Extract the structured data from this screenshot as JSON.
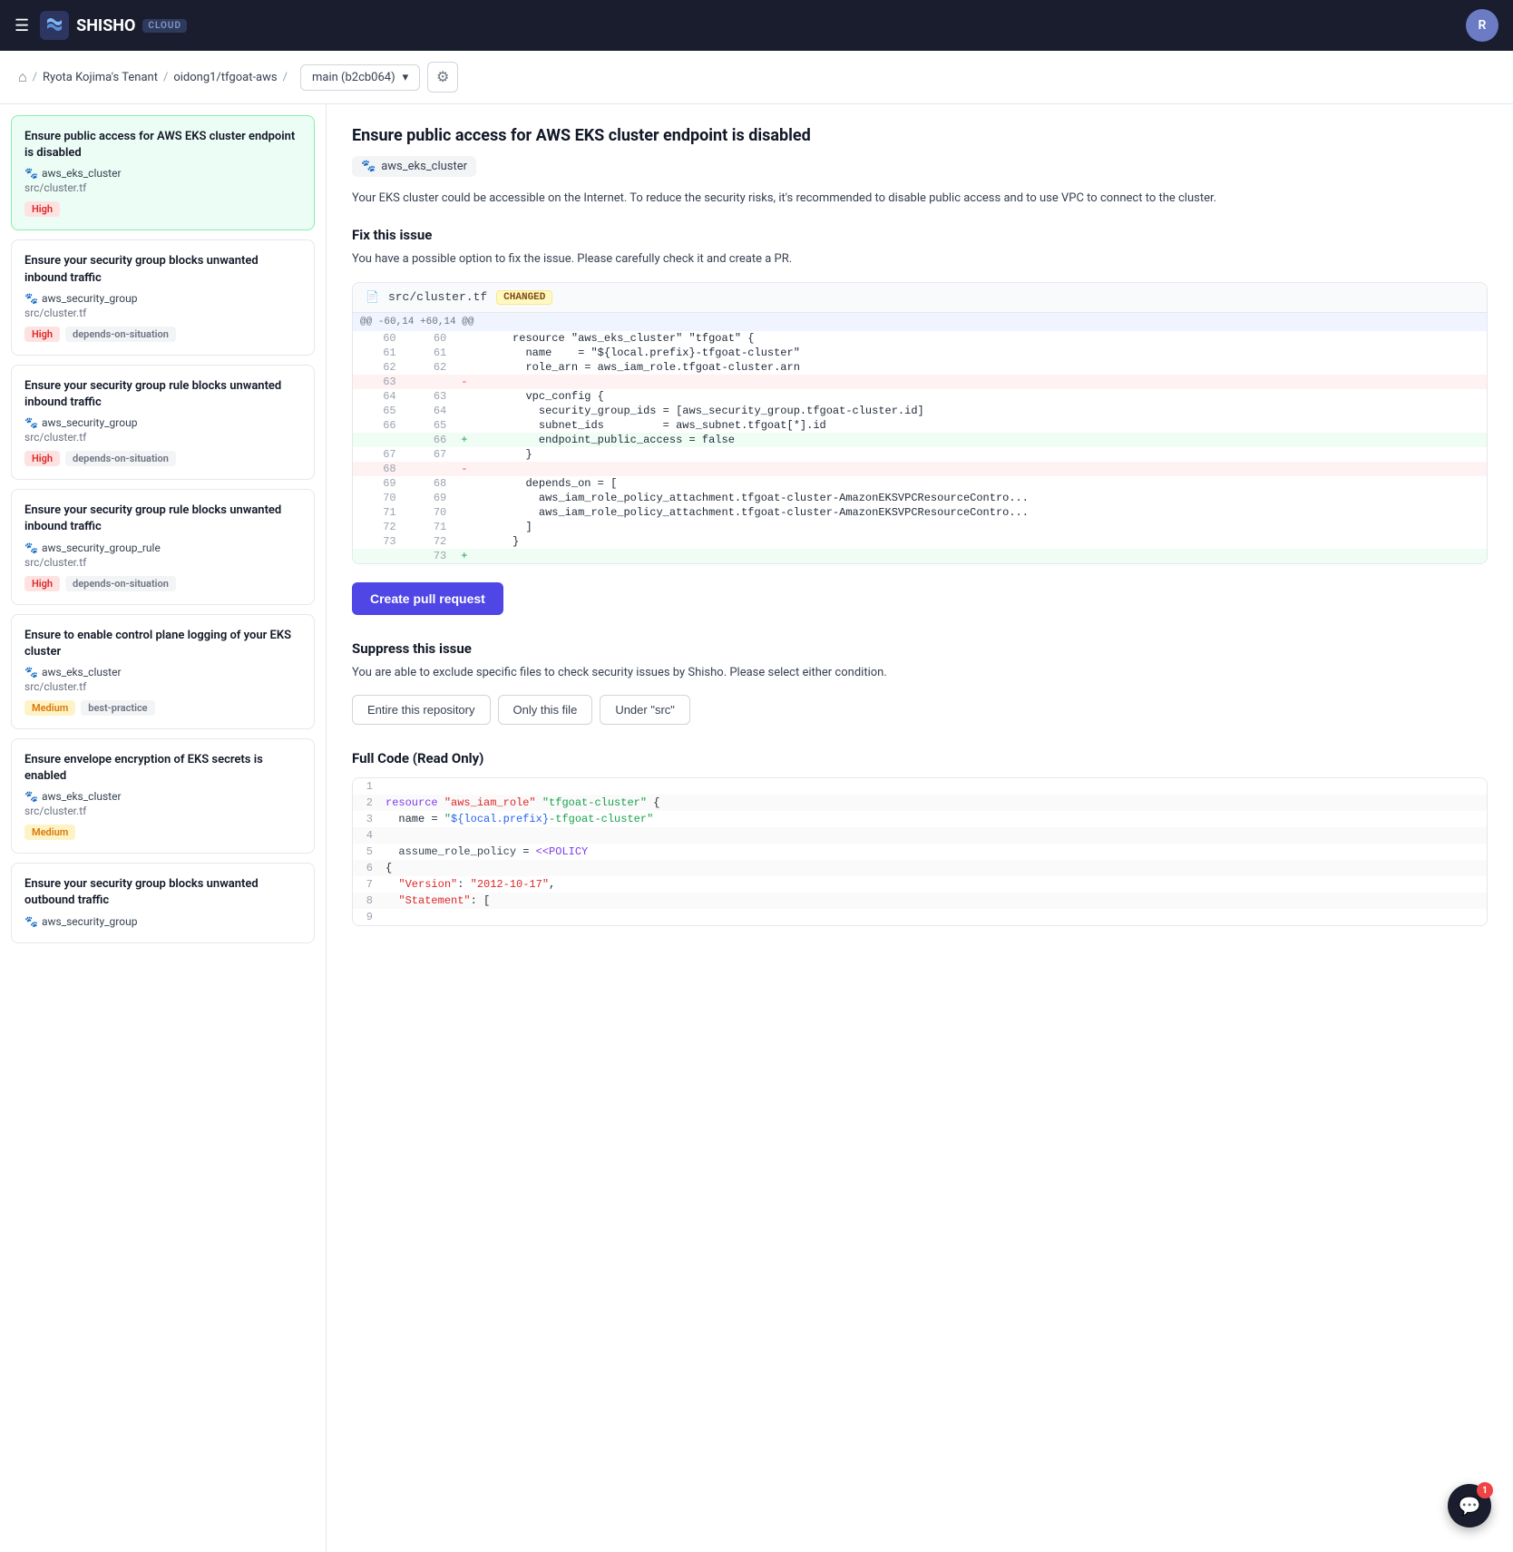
{
  "navbar": {
    "logo_text": "SHISHO",
    "cloud_label": "CLOUD",
    "hamburger_icon": "☰",
    "avatar_label": "R"
  },
  "breadcrumb": {
    "home_icon": "⌂",
    "tenant": "Ryota Kojima's Tenant",
    "repo": "oidong1/tfgoat-aws",
    "branch": "main (b2cb064)",
    "settings_icon": "⚙"
  },
  "sidebar": {
    "issues": [
      {
        "title": "Ensure public access for AWS EKS cluster endpoint is disabled",
        "resource": "aws_eks_cluster",
        "file": "src/cluster.tf",
        "badges": [
          "High"
        ],
        "active": true
      },
      {
        "title": "Ensure your security group blocks unwanted inbound traffic",
        "resource": "aws_security_group",
        "file": "src/cluster.tf",
        "badges": [
          "High",
          "depends-on-situation"
        ],
        "active": false
      },
      {
        "title": "Ensure your security group rule blocks unwanted inbound traffic",
        "resource": "aws_security_group",
        "file": "src/cluster.tf",
        "badges": [
          "High",
          "depends-on-situation"
        ],
        "active": false
      },
      {
        "title": "Ensure your security group rule blocks unwanted inbound traffic",
        "resource": "aws_security_group_rule",
        "file": "src/cluster.tf",
        "badges": [
          "High",
          "depends-on-situation"
        ],
        "active": false
      },
      {
        "title": "Ensure to enable control plane logging of your EKS cluster",
        "resource": "aws_eks_cluster",
        "file": "src/cluster.tf",
        "badges": [
          "Medium",
          "best-practice"
        ],
        "active": false
      },
      {
        "title": "Ensure envelope encryption of EKS secrets is enabled",
        "resource": "aws_eks_cluster",
        "file": "src/cluster.tf",
        "badges": [
          "Medium"
        ],
        "active": false
      },
      {
        "title": "Ensure your security group blocks unwanted outbound traffic",
        "resource": "aws_security_group",
        "file": "",
        "badges": [],
        "active": false
      }
    ]
  },
  "content": {
    "issue_title": "Ensure public access for AWS EKS cluster endpoint is disabled",
    "resource_tag": "aws_eks_cluster",
    "description": "Your EKS cluster could be accessible on the Internet. To reduce the security risks, it's recommended to disable public access and to use VPC to connect to the cluster.",
    "fix_title": "Fix this issue",
    "fix_description": "You have a possible option to fix the issue. Please carefully check it and create a PR.",
    "code_file": "src/cluster.tf",
    "changed_label": "CHANGED",
    "diff_meta": "@@ -60,14 +60,14 @@",
    "diff_lines": [
      {
        "old": "60",
        "new": "60",
        "type": "neutral",
        "sign": " ",
        "code": "  resource \"aws_eks_cluster\" \"tfgoat\" {"
      },
      {
        "old": "61",
        "new": "61",
        "type": "neutral",
        "sign": " ",
        "code": "    name    = \"${local.prefix}-tfgoat-cluster\""
      },
      {
        "old": "62",
        "new": "62",
        "type": "neutral",
        "sign": " ",
        "code": "    role_arn = aws_iam_role.tfgoat-cluster.arn"
      },
      {
        "old": "63",
        "new": "",
        "type": "del",
        "sign": "-",
        "code": ""
      },
      {
        "old": "64",
        "new": "63",
        "type": "neutral",
        "sign": " ",
        "code": "    vpc_config {"
      },
      {
        "old": "65",
        "new": "64",
        "type": "neutral",
        "sign": " ",
        "code": "      security_group_ids = [aws_security_group.tfgoat-cluster.id]"
      },
      {
        "old": "66",
        "new": "65",
        "type": "neutral",
        "sign": " ",
        "code": "      subnet_ids         = aws_subnet.tfgoat[*].id"
      },
      {
        "old": "",
        "new": "66",
        "type": "add",
        "sign": "+",
        "code": "      endpoint_public_access = false"
      },
      {
        "old": "67",
        "new": "67",
        "type": "neutral",
        "sign": " ",
        "code": "    }"
      },
      {
        "old": "68",
        "new": "",
        "type": "del",
        "sign": "-",
        "code": ""
      },
      {
        "old": "69",
        "new": "68",
        "type": "neutral",
        "sign": " ",
        "code": "    depends_on = ["
      },
      {
        "old": "70",
        "new": "69",
        "type": "neutral",
        "sign": " ",
        "code": "      aws_iam_role_policy_attachment.tfgoat-cluster-AmazonEKSVPCResourceContro..."
      },
      {
        "old": "71",
        "new": "70",
        "type": "neutral",
        "sign": " ",
        "code": "      aws_iam_role_policy_attachment.tfgoat-cluster-AmazonEKSVPCResourceContro..."
      },
      {
        "old": "72",
        "new": "71",
        "type": "neutral",
        "sign": " ",
        "code": "    ]"
      },
      {
        "old": "73",
        "new": "72",
        "type": "neutral",
        "sign": " ",
        "code": "  }"
      },
      {
        "old": "",
        "new": "73",
        "type": "add",
        "sign": "+",
        "code": ""
      }
    ],
    "create_pr_label": "Create pull request",
    "suppress_title": "Suppress this issue",
    "suppress_description": "You are able to exclude specific files to check security issues by Shisho. Please select either condition.",
    "suppress_buttons": [
      "Entire this repository",
      "Only this file",
      "Under \"src\""
    ],
    "full_code_title": "Full Code (Read Only)",
    "full_code_lines": [
      {
        "num": "1",
        "code": ""
      },
      {
        "num": "2",
        "code": "resource \"aws_iam_role\" \"tfgoat-cluster\" {"
      },
      {
        "num": "3",
        "code": "  name = \"${local.prefix}-tfgoat-cluster\""
      },
      {
        "num": "4",
        "code": ""
      },
      {
        "num": "5",
        "code": "  assume_role_policy = <<POLICY"
      },
      {
        "num": "6",
        "code": "{"
      },
      {
        "num": "7",
        "code": "  \"Version\": \"2012-10-17\","
      },
      {
        "num": "8",
        "code": "  \"Statement\": ["
      },
      {
        "num": "9",
        "code": ""
      }
    ]
  },
  "chat": {
    "badge_count": "1",
    "icon": "💬"
  }
}
